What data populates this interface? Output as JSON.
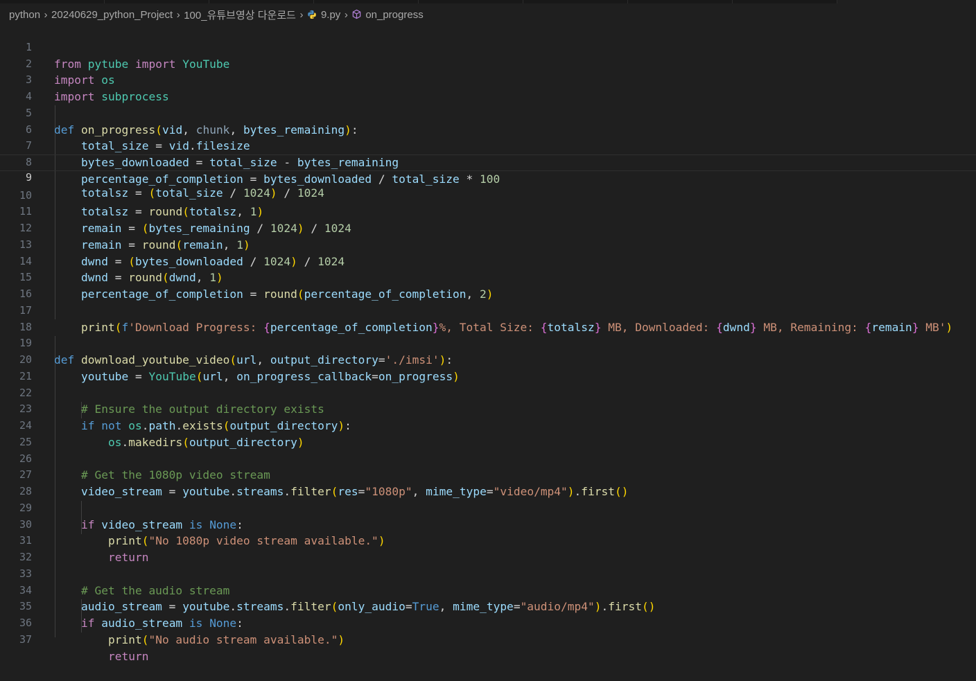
{
  "breadcrumb": {
    "items": [
      "python",
      "20240629_python_Project",
      "100_유튜브영상 다운로드",
      "9.py",
      "on_progress"
    ]
  },
  "editor": {
    "current_line": 9,
    "lines": [
      {
        "n": "1",
        "code": "from pytube import YouTube"
      },
      {
        "n": "2",
        "code": "import os"
      },
      {
        "n": "3",
        "code": "import subprocess"
      },
      {
        "n": "4",
        "code": ""
      },
      {
        "n": "5",
        "code": "def on_progress(vid, chunk, bytes_remaining):"
      },
      {
        "n": "6",
        "code": "    total_size = vid.filesize"
      },
      {
        "n": "7",
        "code": "    bytes_downloaded = total_size - bytes_remaining"
      },
      {
        "n": "8",
        "code": "    percentage_of_completion = bytes_downloaded / total_size * 100"
      },
      {
        "n": "9",
        "code": "    totalsz = (total_size / 1024) / 1024"
      },
      {
        "n": "10",
        "code": "    totalsz = round(totalsz, 1)"
      },
      {
        "n": "11",
        "code": "    remain = (bytes_remaining / 1024) / 1024"
      },
      {
        "n": "12",
        "code": "    remain = round(remain, 1)"
      },
      {
        "n": "13",
        "code": "    dwnd = (bytes_downloaded / 1024) / 1024"
      },
      {
        "n": "14",
        "code": "    dwnd = round(dwnd, 1)"
      },
      {
        "n": "15",
        "code": "    percentage_of_completion = round(percentage_of_completion, 2)"
      },
      {
        "n": "16",
        "code": ""
      },
      {
        "n": "17",
        "code": "    print(f'Download Progress: {percentage_of_completion}%, Total Size: {totalsz} MB, Downloaded: {dwnd} MB, Remaining: {remain} MB')"
      },
      {
        "n": "18",
        "code": ""
      },
      {
        "n": "19",
        "code": "def download_youtube_video(url, output_directory='./imsi'):"
      },
      {
        "n": "20",
        "code": "    youtube = YouTube(url, on_progress_callback=on_progress)"
      },
      {
        "n": "21",
        "code": ""
      },
      {
        "n": "22",
        "code": "    # Ensure the output directory exists"
      },
      {
        "n": "23",
        "code": "    if not os.path.exists(output_directory):"
      },
      {
        "n": "24",
        "code": "        os.makedirs(output_directory)"
      },
      {
        "n": "25",
        "code": ""
      },
      {
        "n": "26",
        "code": "    # Get the 1080p video stream"
      },
      {
        "n": "27",
        "code": "    video_stream = youtube.streams.filter(res=\"1080p\", mime_type=\"video/mp4\").first()"
      },
      {
        "n": "28",
        "code": ""
      },
      {
        "n": "29",
        "code": "    if video_stream is None:"
      },
      {
        "n": "30",
        "code": "        print(\"No 1080p video stream available.\")"
      },
      {
        "n": "31",
        "code": "        return"
      },
      {
        "n": "32",
        "code": ""
      },
      {
        "n": "33",
        "code": "    # Get the audio stream"
      },
      {
        "n": "34",
        "code": "    audio_stream = youtube.streams.filter(only_audio=True, mime_type=\"audio/mp4\").first()"
      },
      {
        "n": "35",
        "code": "    if audio_stream is None:"
      },
      {
        "n": "36",
        "code": "        print(\"No audio stream available.\")"
      },
      {
        "n": "37",
        "code": "        return"
      }
    ]
  }
}
